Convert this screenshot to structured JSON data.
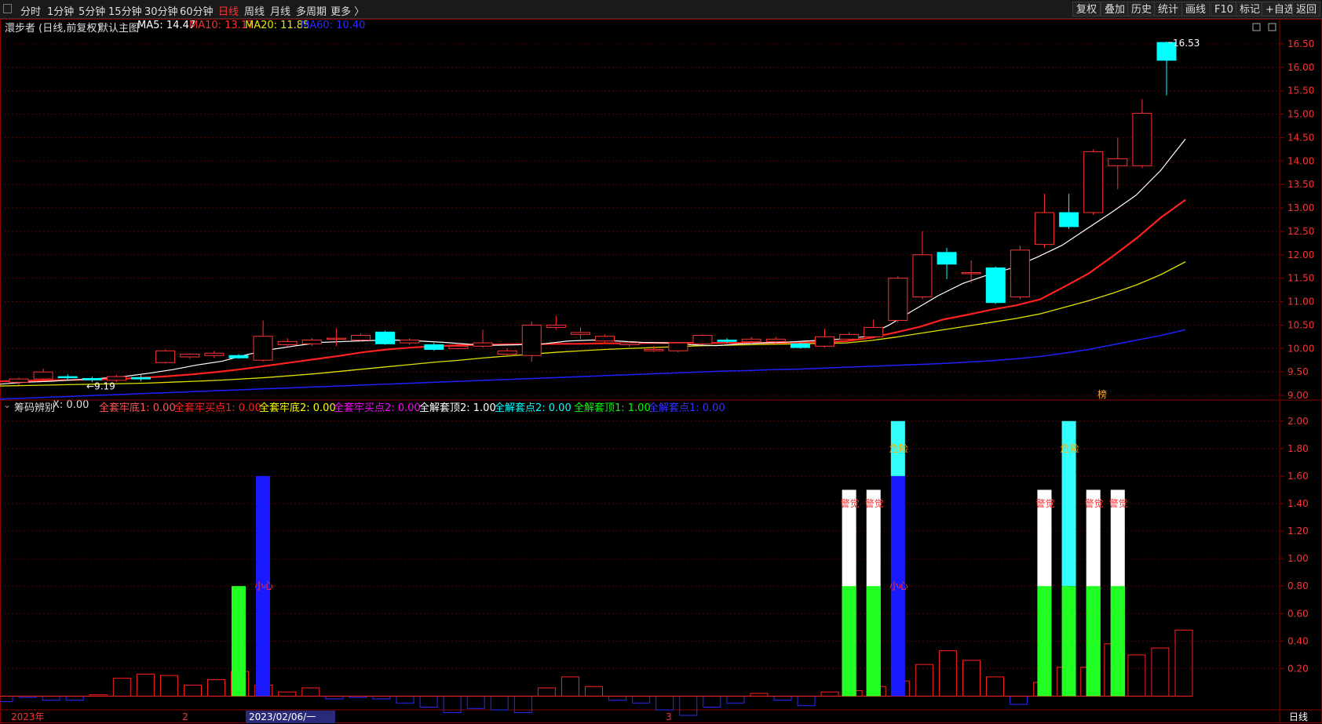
{
  "toolbar": {
    "periods": [
      "分时",
      "1分钟",
      "5分钟",
      "15分钟",
      "30分钟",
      "60分钟",
      "日线",
      "周线",
      "月线",
      "多周期",
      "更多 〉"
    ],
    "active_period": "日线",
    "right_buttons": [
      "复权",
      "叠加",
      "历史",
      "统计",
      "画线",
      "F10",
      "标记",
      "+自选",
      "返回"
    ]
  },
  "main_info": {
    "title": "澴步者 (日线,前复权)",
    "template": "默认主图",
    "ma5": "MA5: 14.47",
    "ma10": "MA10: 13.17",
    "ma20": "MA20: 11.85",
    "ma60": "MA60: 10.40"
  },
  "sub_info": {
    "title": "筹码辨别",
    "x": "X: 0.00",
    "items": [
      {
        "label": "全套牢底1: 0.00",
        "color": "#ff5555"
      },
      {
        "label": "全套牢买点1: 0.00",
        "color": "#ff2222"
      },
      {
        "label": "全套牢底2: 0.00",
        "color": "#ffff00"
      },
      {
        "label": "全套牢买点2: 0.00",
        "color": "#ff00ff"
      },
      {
        "label": "全解套顶2: 1.00",
        "color": "#ffffff"
      },
      {
        "label": "全解套点2: 0.00",
        "color": "#00ffff"
      },
      {
        "label": "全解套顶1: 1.00",
        "color": "#00ff00"
      },
      {
        "label": "全解套点1: 0.00",
        "color": "#3333ff"
      }
    ]
  },
  "colors": {
    "up": "#ff3333",
    "down": "#00ffff",
    "ma5": "#ffffff",
    "ma10": "#ff2020",
    "ma20": "#e0e000",
    "ma60": "#2020ff",
    "grid": "#5a0000",
    "axis_text": "#ff3333"
  },
  "chart_data": [
    {
      "type": "candlestick",
      "ylim": [
        8.9,
        16.7
      ],
      "yticks": [
        "16.50",
        "16.00",
        "15.50",
        "15.00",
        "14.50",
        "14.00",
        "13.50",
        "13.00",
        "12.50",
        "12.00",
        "11.50",
        "11.00",
        "10.50",
        "10.00",
        "9.50",
        "9.00"
      ],
      "annotations": {
        "high_label": "16.53",
        "low_label": "←9.19",
        "rank_mark": "榜"
      },
      "candles": [
        [
          9.28,
          9.35,
          9.22,
          9.38
        ],
        [
          9.35,
          9.5,
          9.3,
          9.57
        ],
        [
          9.4,
          9.38,
          9.33,
          9.45
        ],
        [
          9.36,
          9.33,
          9.28,
          9.4
        ],
        [
          9.32,
          9.4,
          9.28,
          9.44
        ],
        [
          9.38,
          9.35,
          9.3,
          9.45
        ],
        [
          9.7,
          9.95,
          9.68,
          9.98
        ],
        [
          9.82,
          9.88,
          9.78,
          9.9
        ],
        [
          9.85,
          9.9,
          9.8,
          9.95
        ],
        [
          9.85,
          9.8,
          9.78,
          9.88
        ],
        [
          9.75,
          10.26,
          9.72,
          10.6
        ],
        [
          10.08,
          10.15,
          10.05,
          10.22
        ],
        [
          10.1,
          10.18,
          10.05,
          10.22
        ],
        [
          10.2,
          10.22,
          10.05,
          10.43
        ],
        [
          10.18,
          10.28,
          10.15,
          10.32
        ],
        [
          10.35,
          10.1,
          10.08,
          10.38
        ],
        [
          10.12,
          10.18,
          10.08,
          10.22
        ],
        [
          10.08,
          9.98,
          9.95,
          10.12
        ],
        [
          10.0,
          10.05,
          9.98,
          10.12
        ],
        [
          10.05,
          10.12,
          10.02,
          10.4
        ],
        [
          9.88,
          9.95,
          9.85,
          10.0
        ],
        [
          9.85,
          10.5,
          9.72,
          10.58
        ],
        [
          10.45,
          10.5,
          10.4,
          10.7
        ],
        [
          10.3,
          10.34,
          10.2,
          10.45
        ],
        [
          10.16,
          10.26,
          10.12,
          10.3
        ],
        [
          10.08,
          10.12,
          10.04,
          10.16
        ],
        [
          9.95,
          9.98,
          9.93,
          10.05
        ],
        [
          9.95,
          10.12,
          9.92,
          10.14
        ],
        [
          10.1,
          10.28,
          10.08,
          10.3
        ],
        [
          10.18,
          10.15,
          10.12,
          10.22
        ],
        [
          10.15,
          10.2,
          10.1,
          10.25
        ],
        [
          10.15,
          10.2,
          10.12,
          10.25
        ],
        [
          10.1,
          10.02,
          10.0,
          10.16
        ],
        [
          10.05,
          10.25,
          10.02,
          10.42
        ],
        [
          10.2,
          10.3,
          10.18,
          10.35
        ],
        [
          10.25,
          10.45,
          10.22,
          10.62
        ],
        [
          10.6,
          11.5,
          10.55,
          11.55
        ],
        [
          11.1,
          12.0,
          11.05,
          12.5
        ],
        [
          12.05,
          11.8,
          11.48,
          12.15
        ],
        [
          11.6,
          11.62,
          11.4,
          11.88
        ],
        [
          11.72,
          10.98,
          10.95,
          11.75
        ],
        [
          11.1,
          12.1,
          11.05,
          12.2
        ],
        [
          12.22,
          12.9,
          12.15,
          13.3
        ],
        [
          12.9,
          12.6,
          12.55,
          13.3
        ],
        [
          12.9,
          14.2,
          12.85,
          14.25
        ],
        [
          13.9,
          14.05,
          13.4,
          14.5
        ],
        [
          13.9,
          15.02,
          13.85,
          15.32
        ],
        [
          16.53,
          16.15,
          15.4,
          16.55
        ]
      ],
      "ma5": [
        9.24,
        9.28,
        9.3,
        9.33,
        9.36,
        9.4,
        9.47,
        9.55,
        9.65,
        9.73,
        9.87,
        9.98,
        10.06,
        10.13,
        10.15,
        10.17,
        10.18,
        10.16,
        10.13,
        10.09,
        10.07,
        10.08,
        10.1,
        10.16,
        10.18,
        10.16,
        10.13,
        10.12,
        10.08,
        10.06,
        10.1,
        10.12,
        10.14,
        10.17,
        10.2,
        10.25,
        10.5,
        10.82,
        11.13,
        11.39,
        11.57,
        11.72,
        11.95,
        12.2,
        12.55,
        12.9,
        13.27,
        13.8,
        14.47
      ],
      "ma10": [
        9.3,
        9.31,
        9.32,
        9.33,
        9.34,
        9.35,
        9.38,
        9.41,
        9.45,
        9.5,
        9.56,
        9.63,
        9.7,
        9.77,
        9.84,
        9.92,
        9.98,
        10.02,
        10.05,
        10.07,
        10.08,
        10.09,
        10.09,
        10.1,
        10.1,
        10.11,
        10.11,
        10.12,
        10.12,
        10.12,
        10.12,
        10.12,
        10.12,
        10.13,
        10.14,
        10.16,
        10.23,
        10.34,
        10.46,
        10.62,
        10.72,
        10.83,
        10.92,
        11.05,
        11.32,
        11.6,
        11.97,
        12.36,
        12.8,
        13.17
      ],
      "ma20": [
        9.2,
        9.21,
        9.22,
        9.23,
        9.24,
        9.25,
        9.26,
        9.28,
        9.3,
        9.32,
        9.35,
        9.38,
        9.42,
        9.46,
        9.51,
        9.56,
        9.61,
        9.66,
        9.71,
        9.75,
        9.8,
        9.84,
        9.88,
        9.92,
        9.95,
        9.98,
        10.0,
        10.02,
        10.04,
        10.06,
        10.07,
        10.08,
        10.09,
        10.1,
        10.11,
        10.12,
        10.17,
        10.24,
        10.32,
        10.4,
        10.48,
        10.56,
        10.64,
        10.74,
        10.88,
        11.02,
        11.18,
        11.36,
        11.58,
        11.85
      ],
      "ma60": [
        8.92,
        8.94,
        8.96,
        8.98,
        9.0,
        9.02,
        9.04,
        9.06,
        9.08,
        9.1,
        9.12,
        9.14,
        9.16,
        9.18,
        9.2,
        9.22,
        9.24,
        9.26,
        9.28,
        9.3,
        9.32,
        9.34,
        9.36,
        9.38,
        9.4,
        9.42,
        9.44,
        9.46,
        9.48,
        9.5,
        9.52,
        9.53,
        9.55,
        9.56,
        9.58,
        9.6,
        9.62,
        9.64,
        9.66,
        9.68,
        9.71,
        9.74,
        9.78,
        9.83,
        9.9,
        9.98,
        10.08,
        10.18,
        10.28,
        10.4
      ]
    },
    {
      "type": "bar",
      "ylim": [
        -0.1,
        2.05
      ],
      "yticks": [
        "2.00",
        "1.80",
        "1.60",
        "1.40",
        "1.20",
        "1.00",
        "0.80",
        "0.60",
        "0.40",
        "0.20"
      ],
      "hist": [
        -0.04,
        -0.01,
        -0.03,
        -0.03,
        0.01,
        0.13,
        0.16,
        0.15,
        0.08,
        0.12,
        0.18,
        0.08,
        0.03,
        0.06,
        -0.02,
        -0.01,
        -0.02,
        -0.05,
        -0.08,
        -0.12,
        -0.09,
        -0.1,
        -0.12,
        0.06,
        0.14,
        0.07,
        -0.03,
        -0.05,
        -0.1,
        -0.14,
        -0.08,
        -0.05,
        0.02,
        -0.03,
        -0.07,
        0.03,
        0.04,
        0.07,
        0.11,
        0.23,
        0.33,
        0.26,
        0.14,
        -0.06,
        0.1,
        0.21,
        0.21,
        0.38,
        0.3,
        0.35,
        0.48
      ],
      "green": [
        [
          9,
          0.8
        ],
        [
          34,
          0.8
        ],
        [
          35,
          0.8
        ],
        [
          42,
          0.8
        ],
        [
          43,
          0.8
        ],
        [
          44,
          0.8
        ],
        [
          45,
          0.8
        ]
      ],
      "white": [
        [
          34,
          1.5
        ],
        [
          35,
          1.5
        ],
        [
          42,
          1.5
        ],
        [
          44,
          1.5
        ],
        [
          45,
          1.5
        ]
      ],
      "blue": [
        [
          10,
          1.6
        ],
        [
          36,
          1.6
        ]
      ],
      "cyan": [
        [
          36,
          2.0
        ],
        [
          43,
          2.0
        ]
      ],
      "cyan_bottoms": [
        [
          36,
          1.6
        ],
        [
          43,
          0.8
        ]
      ],
      "labels": [
        {
          "i": 10,
          "y": 0.8,
          "text": "小心",
          "color": "#ff3333"
        },
        {
          "i": 36,
          "y": 0.8,
          "text": "小心",
          "color": "#ff3333"
        },
        {
          "i": 34,
          "y": 1.4,
          "text": "警觉",
          "color": "#ff3333"
        },
        {
          "i": 35,
          "y": 1.4,
          "text": "警觉",
          "color": "#ff3333"
        },
        {
          "i": 42,
          "y": 1.4,
          "text": "警觉",
          "color": "#ff3333"
        },
        {
          "i": 44,
          "y": 1.4,
          "text": "警觉",
          "color": "#ff3333"
        },
        {
          "i": 45,
          "y": 1.4,
          "text": "警觉",
          "color": "#ff3333"
        },
        {
          "i": 36,
          "y": 1.8,
          "text": "危险",
          "color": "#ffaa00"
        },
        {
          "i": 43,
          "y": 1.8,
          "text": "危险",
          "color": "#ffaa00"
        }
      ]
    }
  ],
  "bottom_axis": {
    "labels": [
      "2023年",
      "2",
      "2023/02/06/一",
      "3"
    ],
    "period_label": "日线"
  }
}
